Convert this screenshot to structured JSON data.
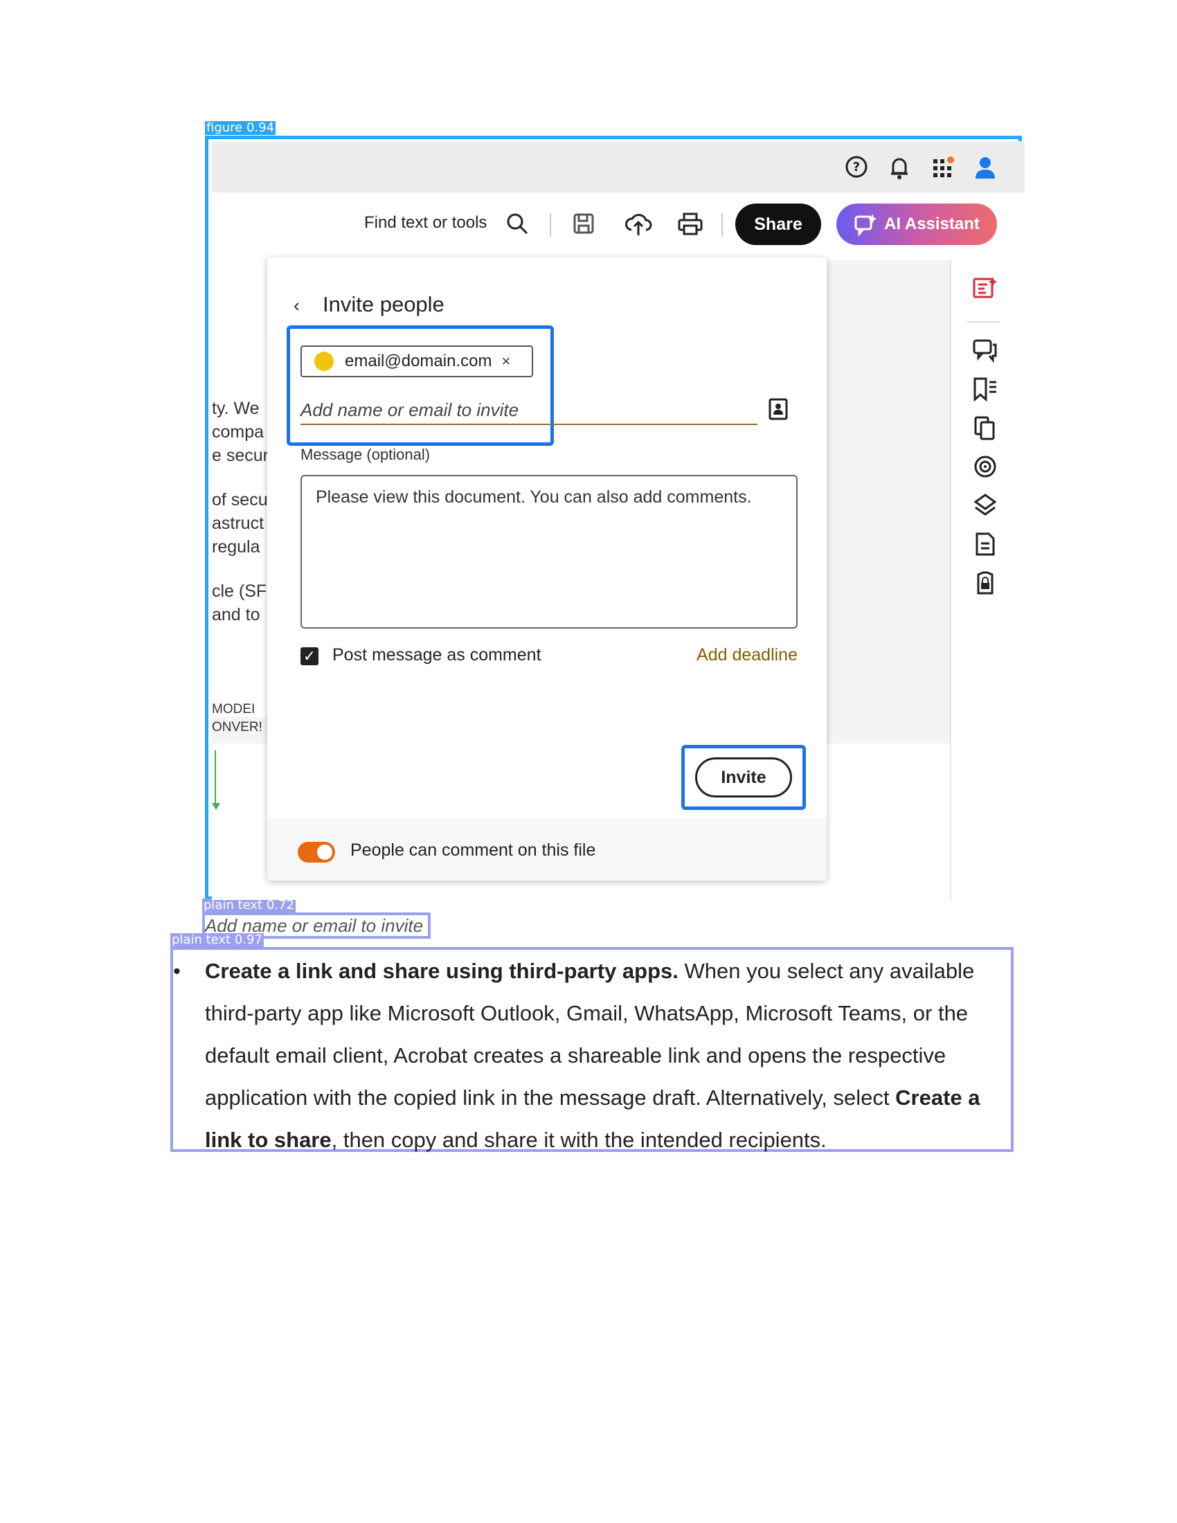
{
  "detections": [
    {
      "label": "figure 0.94"
    },
    {
      "label": "plain text 0.72"
    },
    {
      "label": "plain text 0.97"
    }
  ],
  "toolbar": {
    "find_label": "Find text or tools",
    "share_label": "Share",
    "ai_label": "AI Assistant"
  },
  "doc_fragments": [
    "ty. We",
    "compa",
    "e secur",
    "of secu",
    "astruct",
    "regula",
    "cle (SF",
    "and to",
    "MODEI",
    "ONVER!"
  ],
  "dialog": {
    "title": "Invite people",
    "chip_email": "email@domain.com",
    "chip_close": "×",
    "invite_placeholder": "Add name or email to invite",
    "message_label": "Message (optional)",
    "message_text": "Please view this document. You can also add comments.",
    "post_message_label": "Post message as comment",
    "deadline_label": "Add deadline",
    "invite_button": "Invite",
    "footer_label": "People can comment on this file"
  },
  "caption": "Add name or email to invite",
  "paragraph": {
    "bullet": "•",
    "bold_lead": "Create a link and share using third-party apps.",
    "text_1": " When you select any available third-party app like Microsoft Outlook, Gmail, WhatsApp, Microsoft Teams, or the default email client, Acrobat creates a shareable link and opens the respective application with the copied link in the message draft. Alternatively, select ",
    "bold_mid": "Create a link to share",
    "text_2": ", then copy and share it with the intended recipients."
  },
  "colors": {
    "figure_box": "#2aa6f2",
    "text_box": "#9aa0ef",
    "highlight": "#1a73e8",
    "toggle_on": "#e66a13",
    "notification_dot": "#f07b22",
    "profile_blue": "#1877f2",
    "rail_accent": "#d92b3a"
  }
}
